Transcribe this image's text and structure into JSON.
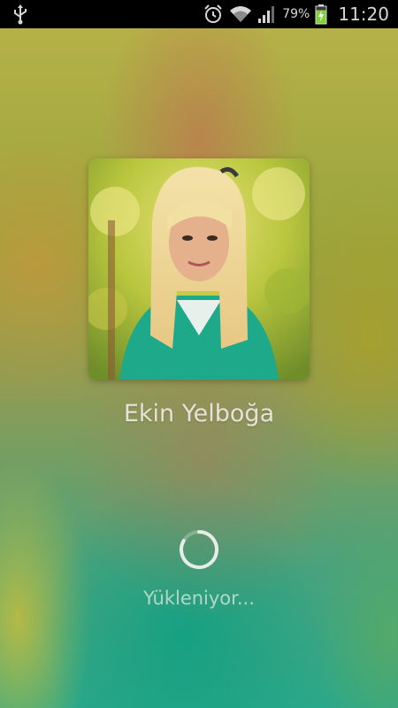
{
  "status_bar": {
    "icons": [
      "usb-icon",
      "alarm-icon",
      "wifi-icon",
      "signal-icon",
      "battery-charging-icon"
    ],
    "battery_percent": "79%",
    "time": "11:20"
  },
  "player": {
    "artist_name": "Ekin Yelboğa",
    "loading_text": "Yükleniyor..."
  },
  "colors": {
    "status_bar_bg": "#000000",
    "artist_text": "#e6e2d8",
    "battery_fill": "#7dd13a"
  }
}
